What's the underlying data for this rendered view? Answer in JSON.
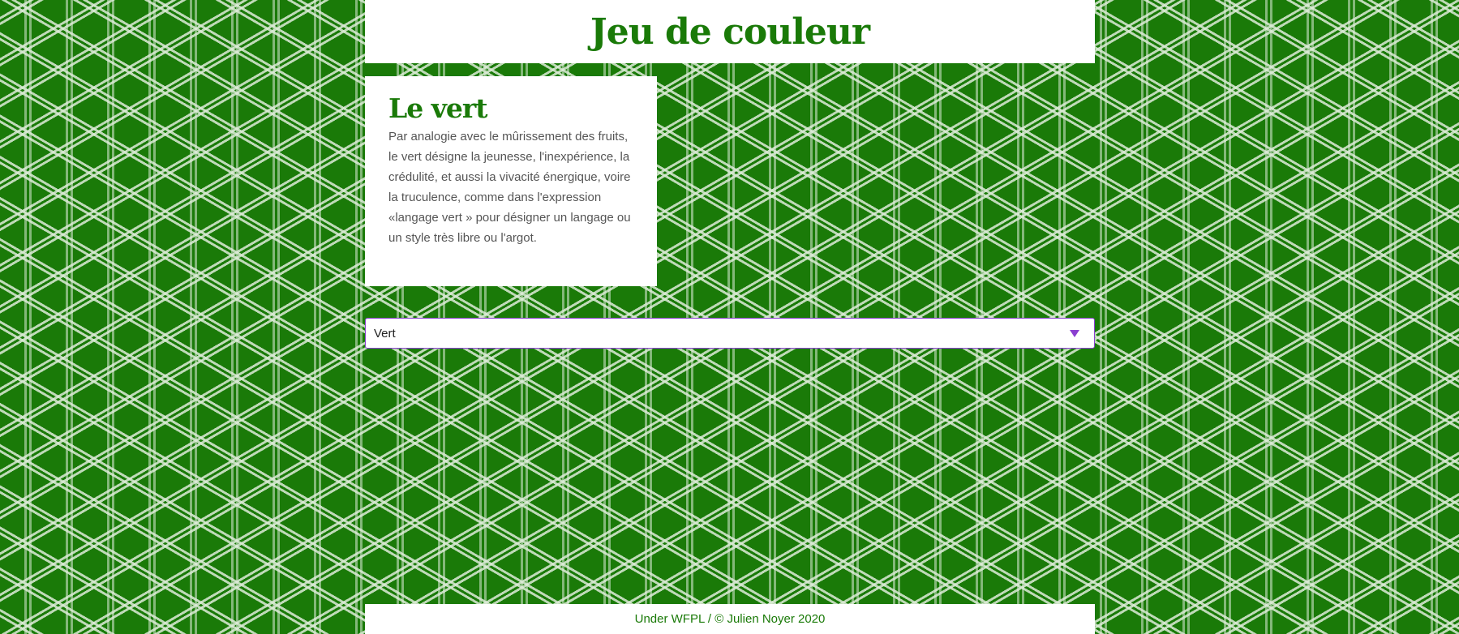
{
  "header": {
    "title": "Jeu de couleur"
  },
  "card": {
    "title": "Le vert",
    "text": "Par analogie avec le mûrissement des fruits, le vert désigne la jeunesse, l'inexpérience, la crédulité, et aussi la vivacité énergique, voire la truculence, comme dans l'expression «langage vert » pour désigner un langage ou un style très libre ou l'argot."
  },
  "color_select": {
    "selected": "Vert",
    "arrow_icon": "triangle-down-icon"
  },
  "footer": {
    "text": "Under WFPL / © Julien Noyer 2020"
  },
  "colors": {
    "accent": "#1a7a08",
    "select_border": "#8a3fd0",
    "text": "#555555"
  }
}
